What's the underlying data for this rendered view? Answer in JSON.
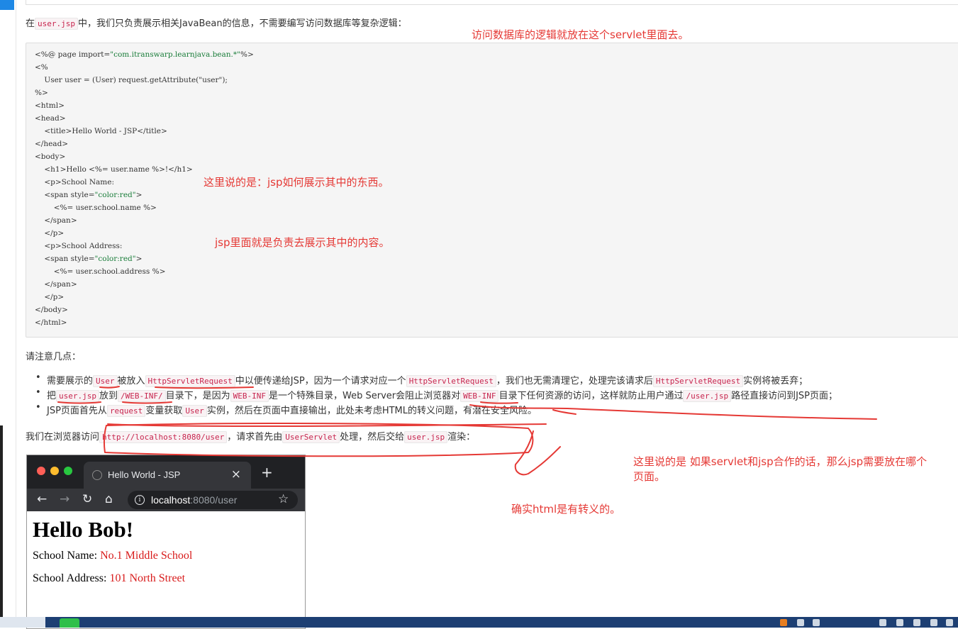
{
  "intro": {
    "before": "在",
    "code": "user.jsp",
    "after": "中，我们只负责展示相关JavaBean的信息，不需要编写访问数据库等复杂逻辑："
  },
  "code_lines": [
    {
      "plain": "<%@ page import=",
      "str": "\"com.itranswarp.learnjava.bean.*\"",
      "tail": "%>"
    },
    {
      "plain": "<%",
      "str": "",
      "tail": ""
    },
    {
      "plain": "    User user = (User) request.getAttribute(\"user\");",
      "str": "",
      "tail": ""
    },
    {
      "plain": "%>",
      "str": "",
      "tail": ""
    },
    {
      "plain": "<html>",
      "str": "",
      "tail": ""
    },
    {
      "plain": "<head>",
      "str": "",
      "tail": ""
    },
    {
      "plain": "    <title>Hello World - JSP</title>",
      "str": "",
      "tail": ""
    },
    {
      "plain": "</head>",
      "str": "",
      "tail": ""
    },
    {
      "plain": "<body>",
      "str": "",
      "tail": ""
    },
    {
      "plain": "    <h1>Hello <%= user.name %>!</h1>",
      "str": "",
      "tail": ""
    },
    {
      "plain": "    <p>School Name:",
      "str": "",
      "tail": ""
    },
    {
      "plain": "    <span style=",
      "str": "\"color:red\"",
      "tail": ">"
    },
    {
      "plain": "        <%= user.school.name %>",
      "str": "",
      "tail": ""
    },
    {
      "plain": "    </span>",
      "str": "",
      "tail": ""
    },
    {
      "plain": "    </p>",
      "str": "",
      "tail": ""
    },
    {
      "plain": "    <p>School Address:",
      "str": "",
      "tail": ""
    },
    {
      "plain": "    <span style=",
      "str": "\"color:red\"",
      "tail": ">"
    },
    {
      "plain": "        <%= user.school.address %>",
      "str": "",
      "tail": ""
    },
    {
      "plain": "    </span>",
      "str": "",
      "tail": ""
    },
    {
      "plain": "    </p>",
      "str": "",
      "tail": ""
    },
    {
      "plain": "</body>",
      "str": "",
      "tail": ""
    },
    {
      "plain": "</html>",
      "str": "",
      "tail": ""
    }
  ],
  "notes_heading": "请注意几点：",
  "bullets": {
    "b1": [
      "需要展示的",
      "User",
      "被放入",
      "HttpServletRequest",
      "中以便传递给JSP，因为一个请求对应一个",
      "HttpServletRequest",
      "，我们也无需清理它，处理完该请求后",
      "HttpServletRequest",
      "实例将被丢弃；"
    ],
    "b2": [
      "把",
      "user.jsp",
      "放到",
      "/WEB-INF/",
      "目录下，是因为",
      "WEB-INF",
      "是一个特殊目录，Web Server会阻止浏览器对",
      "WEB-INF",
      "目录下任何资源的访问，这样就防止用户通过",
      "/user.jsp",
      "路径直接访问到JSP页面；"
    ],
    "b3": [
      "JSP页面首先从",
      "request",
      "变量获取",
      "User",
      "实例，然后在页面中直接输出，此处未考虑HTML的转义问题，有潜在安全风险。"
    ]
  },
  "browse": [
    "我们在浏览器访问",
    "http://localhost:8080/user",
    "，请求首先由",
    "UserServlet",
    "处理，然后交给",
    "user.jsp",
    "渲染："
  ],
  "annotations": {
    "a1": "访问数据库的逻辑就放在这个servlet里面去。",
    "a2": "这里说的是：jsp如何展示其中的东西。",
    "a3": "jsp里面就是负责去展示其中的内容。",
    "a4_line1": "这里说的是 如果servlet和jsp合作的话，那么jsp需要放在哪个",
    "a4_line2": "页面。",
    "a5": "确实html是有转义的。"
  },
  "browser": {
    "tab_title": "Hello World - JSP",
    "tab_close": "×",
    "new_tab": "+",
    "url_host": "localhost",
    "url_path": ":8080/user",
    "heading": "Hello Bob!",
    "school_name_label": "School Name: ",
    "school_name_value": "No.1 Middle School",
    "school_address_label": "School Address: ",
    "school_address_value": "101 North Street"
  },
  "colors": {
    "annotation": "#e53935",
    "traffic_red": "#ff5f57",
    "traffic_yellow": "#febc2e",
    "traffic_green": "#28c840"
  },
  "icons": [
    "back-arrow-icon",
    "forward-arrow-icon",
    "reload-icon",
    "home-icon",
    "info-icon",
    "star-icon",
    "globe-icon"
  ]
}
